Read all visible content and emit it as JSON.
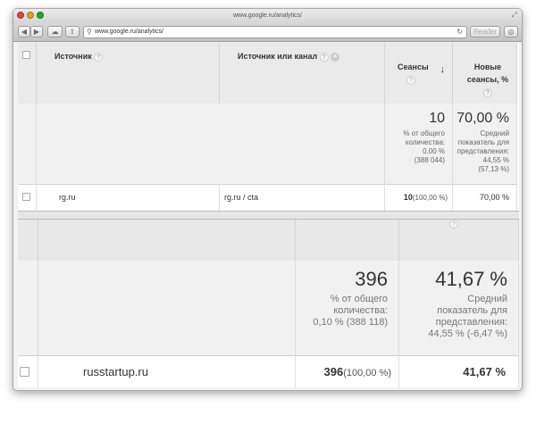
{
  "browser": {
    "title": "www.google.ru/analytics/",
    "url": "www.google.ru/analytics/",
    "reader_label": "Reader"
  },
  "table1": {
    "columns": {
      "source": "Источник",
      "source_medium": "Источник или канал",
      "sessions": "Сеансы",
      "new_sessions": "Новые сеансы, %"
    },
    "summary": {
      "sessions_value": "10",
      "sessions_note": [
        "% от общего",
        "количества:",
        "0,00 %",
        "(388 044)"
      ],
      "new_value": "70,00 %",
      "new_note": [
        "Средний",
        "показатель для",
        "представления:",
        "44,55 %",
        "(57,13 %)"
      ]
    },
    "row": {
      "source": "rg.ru",
      "source_medium": "rg.ru / cta",
      "sessions_value": "10",
      "sessions_pct": "(100,00 %)",
      "new_pct": "70,00 %"
    }
  },
  "table2": {
    "summary": {
      "sessions_value": "396",
      "sessions_note": [
        "% от общего",
        "количества:",
        "0,10 % (388 118)"
      ],
      "new_value": "41,67 %",
      "new_note": [
        "Средний",
        "показатель для",
        "представления:",
        "44,55 % (-6,47 %)"
      ]
    },
    "row": {
      "source": "russtartup.ru",
      "sessions_value": "396",
      "sessions_pct": "(100,00 %)",
      "new_pct": "41,67 %"
    }
  }
}
